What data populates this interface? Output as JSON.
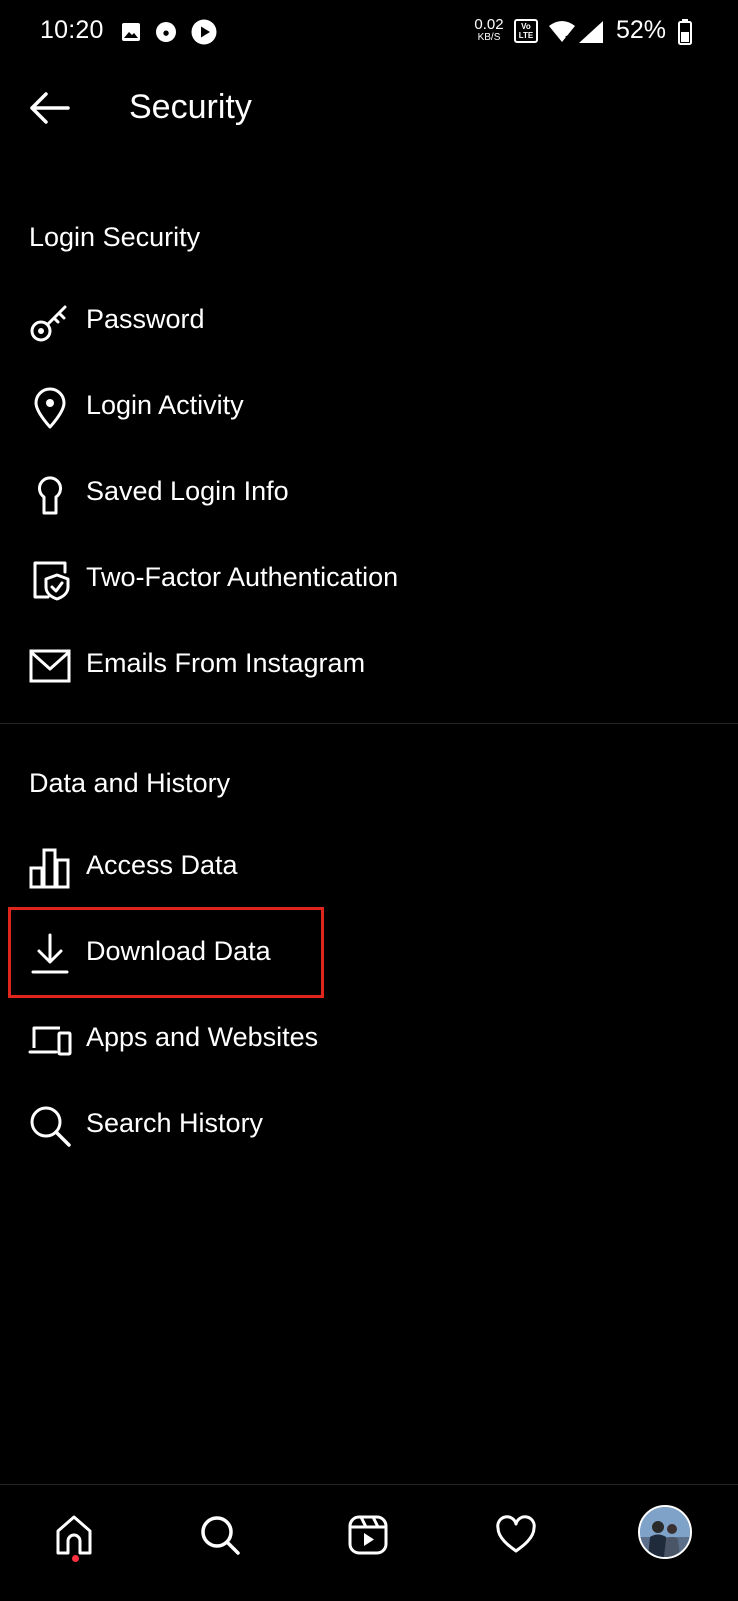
{
  "status_bar": {
    "time": "10:20",
    "net_speed_value": "0.02",
    "net_speed_unit": "KB/S",
    "volte_label_top": "Vo",
    "volte_label_bottom": "LTE",
    "battery_percent": "52%",
    "icons": [
      "gallery-icon",
      "app-notification-icon",
      "play-icon",
      "wifi-icon",
      "signal-icon",
      "battery-icon"
    ]
  },
  "header": {
    "title": "Security",
    "back_icon": "arrow-left-icon"
  },
  "login_security": {
    "title": "Login Security",
    "items": [
      {
        "label": "Password",
        "icon": "key-icon"
      },
      {
        "label": "Login Activity",
        "icon": "location-pin-icon"
      },
      {
        "label": "Saved Login Info",
        "icon": "keyhole-icon"
      },
      {
        "label": "Two-Factor Authentication",
        "icon": "shield-check-icon"
      },
      {
        "label": "Emails From Instagram",
        "icon": "mail-icon"
      }
    ]
  },
  "data_history": {
    "title": "Data and History",
    "items": [
      {
        "label": "Access Data",
        "icon": "bar-chart-icon"
      },
      {
        "label": "Download Data",
        "icon": "download-icon"
      },
      {
        "label": "Apps and Websites",
        "icon": "devices-icon"
      },
      {
        "label": "Search History",
        "icon": "search-icon"
      }
    ]
  },
  "highlight_color": "#e0261c",
  "bottom_nav": {
    "items": [
      "home-icon",
      "search-icon",
      "reels-icon",
      "heart-icon",
      "profile-avatar"
    ],
    "notification_dot_color": "#ff3040"
  }
}
